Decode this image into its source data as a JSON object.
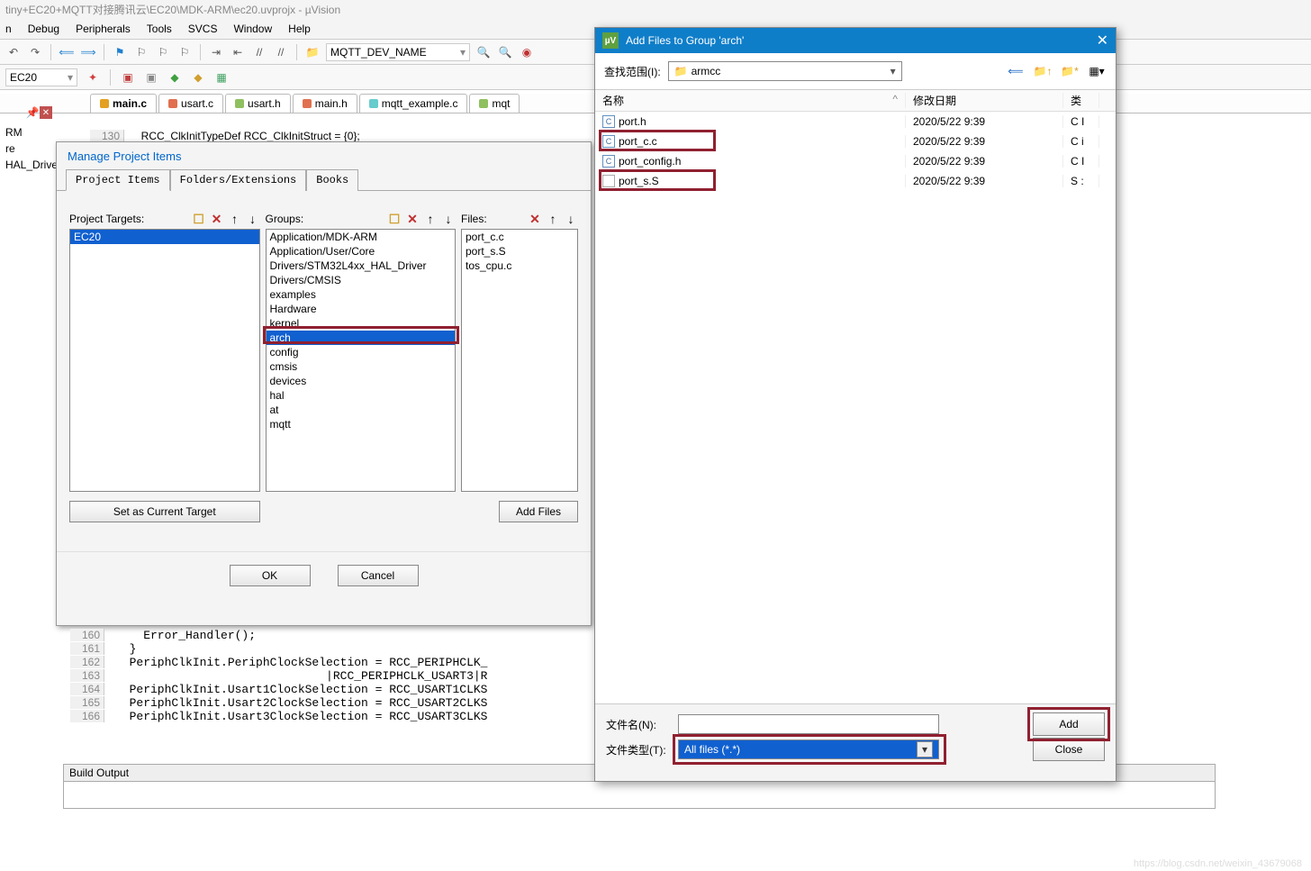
{
  "window": {
    "title": "tiny+EC20+MQTT对接腾讯云\\EC20\\MDK-ARM\\ec20.uvprojx - µVision"
  },
  "menu": {
    "items": [
      "n",
      "Debug",
      "Peripherals",
      "Tools",
      "SVCS",
      "Window",
      "Help"
    ]
  },
  "toolbar": {
    "search_value": "MQTT_DEV_NAME"
  },
  "target_combo": "EC20",
  "tree": {
    "items": [
      "RM",
      "re",
      "HAL_Drive"
    ]
  },
  "tabs": [
    {
      "label": "main.c",
      "cls": "red",
      "active": true
    },
    {
      "label": "usart.c",
      "cls": "orange"
    },
    {
      "label": "usart.h",
      "cls": "green"
    },
    {
      "label": "main.h",
      "cls": "orange"
    },
    {
      "label": "mqtt_example.c",
      "cls": "cyan"
    },
    {
      "label": "mqt",
      "cls": "green"
    }
  ],
  "code_top": {
    "line_num": "130",
    "line_text": "  RCC_ClkInitTypeDef RCC_ClkInitStruct = {0};"
  },
  "manage": {
    "title": "Manage Project Items",
    "tabs": [
      "Project Items",
      "Folders/Extensions",
      "Books"
    ],
    "targets_label": "Project Targets:",
    "groups_label": "Groups:",
    "files_label": "Files:",
    "targets": [
      "EC20"
    ],
    "groups": [
      "Application/MDK-ARM",
      "Application/User/Core",
      "Drivers/STM32L4xx_HAL_Driver",
      "Drivers/CMSIS",
      "examples",
      "Hardware",
      "kernel",
      "arch",
      "config",
      "cmsis",
      "devices",
      "hal",
      "at",
      "mqtt"
    ],
    "groups_selected": "arch",
    "files": [
      "port_c.c",
      "port_s.S",
      "tos_cpu.c"
    ],
    "set_current": "Set as Current Target",
    "add_files": "Add Files",
    "ok": "OK",
    "cancel": "Cancel"
  },
  "code_lower": [
    {
      "n": "160",
      "t": "    Error_Handler();"
    },
    {
      "n": "161",
      "t": "  }"
    },
    {
      "n": "162",
      "t": "  PeriphClkInit.PeriphClockSelection = RCC_PERIPHCLK_"
    },
    {
      "n": "163",
      "t": "                              |RCC_PERIPHCLK_USART3|R"
    },
    {
      "n": "164",
      "t": "  PeriphClkInit.Usart1ClockSelection = RCC_USART1CLKS"
    },
    {
      "n": "165",
      "t": "  PeriphClkInit.Usart2ClockSelection = RCC_USART2CLKS"
    },
    {
      "n": "166",
      "t": "  PeriphClkInit.Usart3ClockSelection = RCC_USART3CLKS"
    }
  ],
  "build_output_label": "Build Output",
  "addfiles": {
    "title": "Add Files to Group 'arch'",
    "lookin_label": "查找范围(I):",
    "folder": "armcc",
    "col_name": "名称",
    "col_date": "修改日期",
    "col_type": "类",
    "files": [
      {
        "name": "port.h",
        "date": "2020/5/22 9:39",
        "type": "C I",
        "icon": "c"
      },
      {
        "name": "port_c.c",
        "date": "2020/5/22 9:39",
        "type": "C i",
        "icon": "c",
        "hl": true
      },
      {
        "name": "port_config.h",
        "date": "2020/5/22 9:39",
        "type": "C I",
        "icon": "c"
      },
      {
        "name": "port_s.S",
        "date": "2020/5/22 9:39",
        "type": "S :",
        "icon": "blank",
        "hl": true
      }
    ],
    "filename_label": "文件名(N):",
    "filetype_label": "文件类型(T):",
    "filetype_value": "All files (*.*)",
    "add_btn": "Add",
    "close_btn": "Close"
  },
  "watermark": "https://blog.csdn.net/weixin_43679068"
}
